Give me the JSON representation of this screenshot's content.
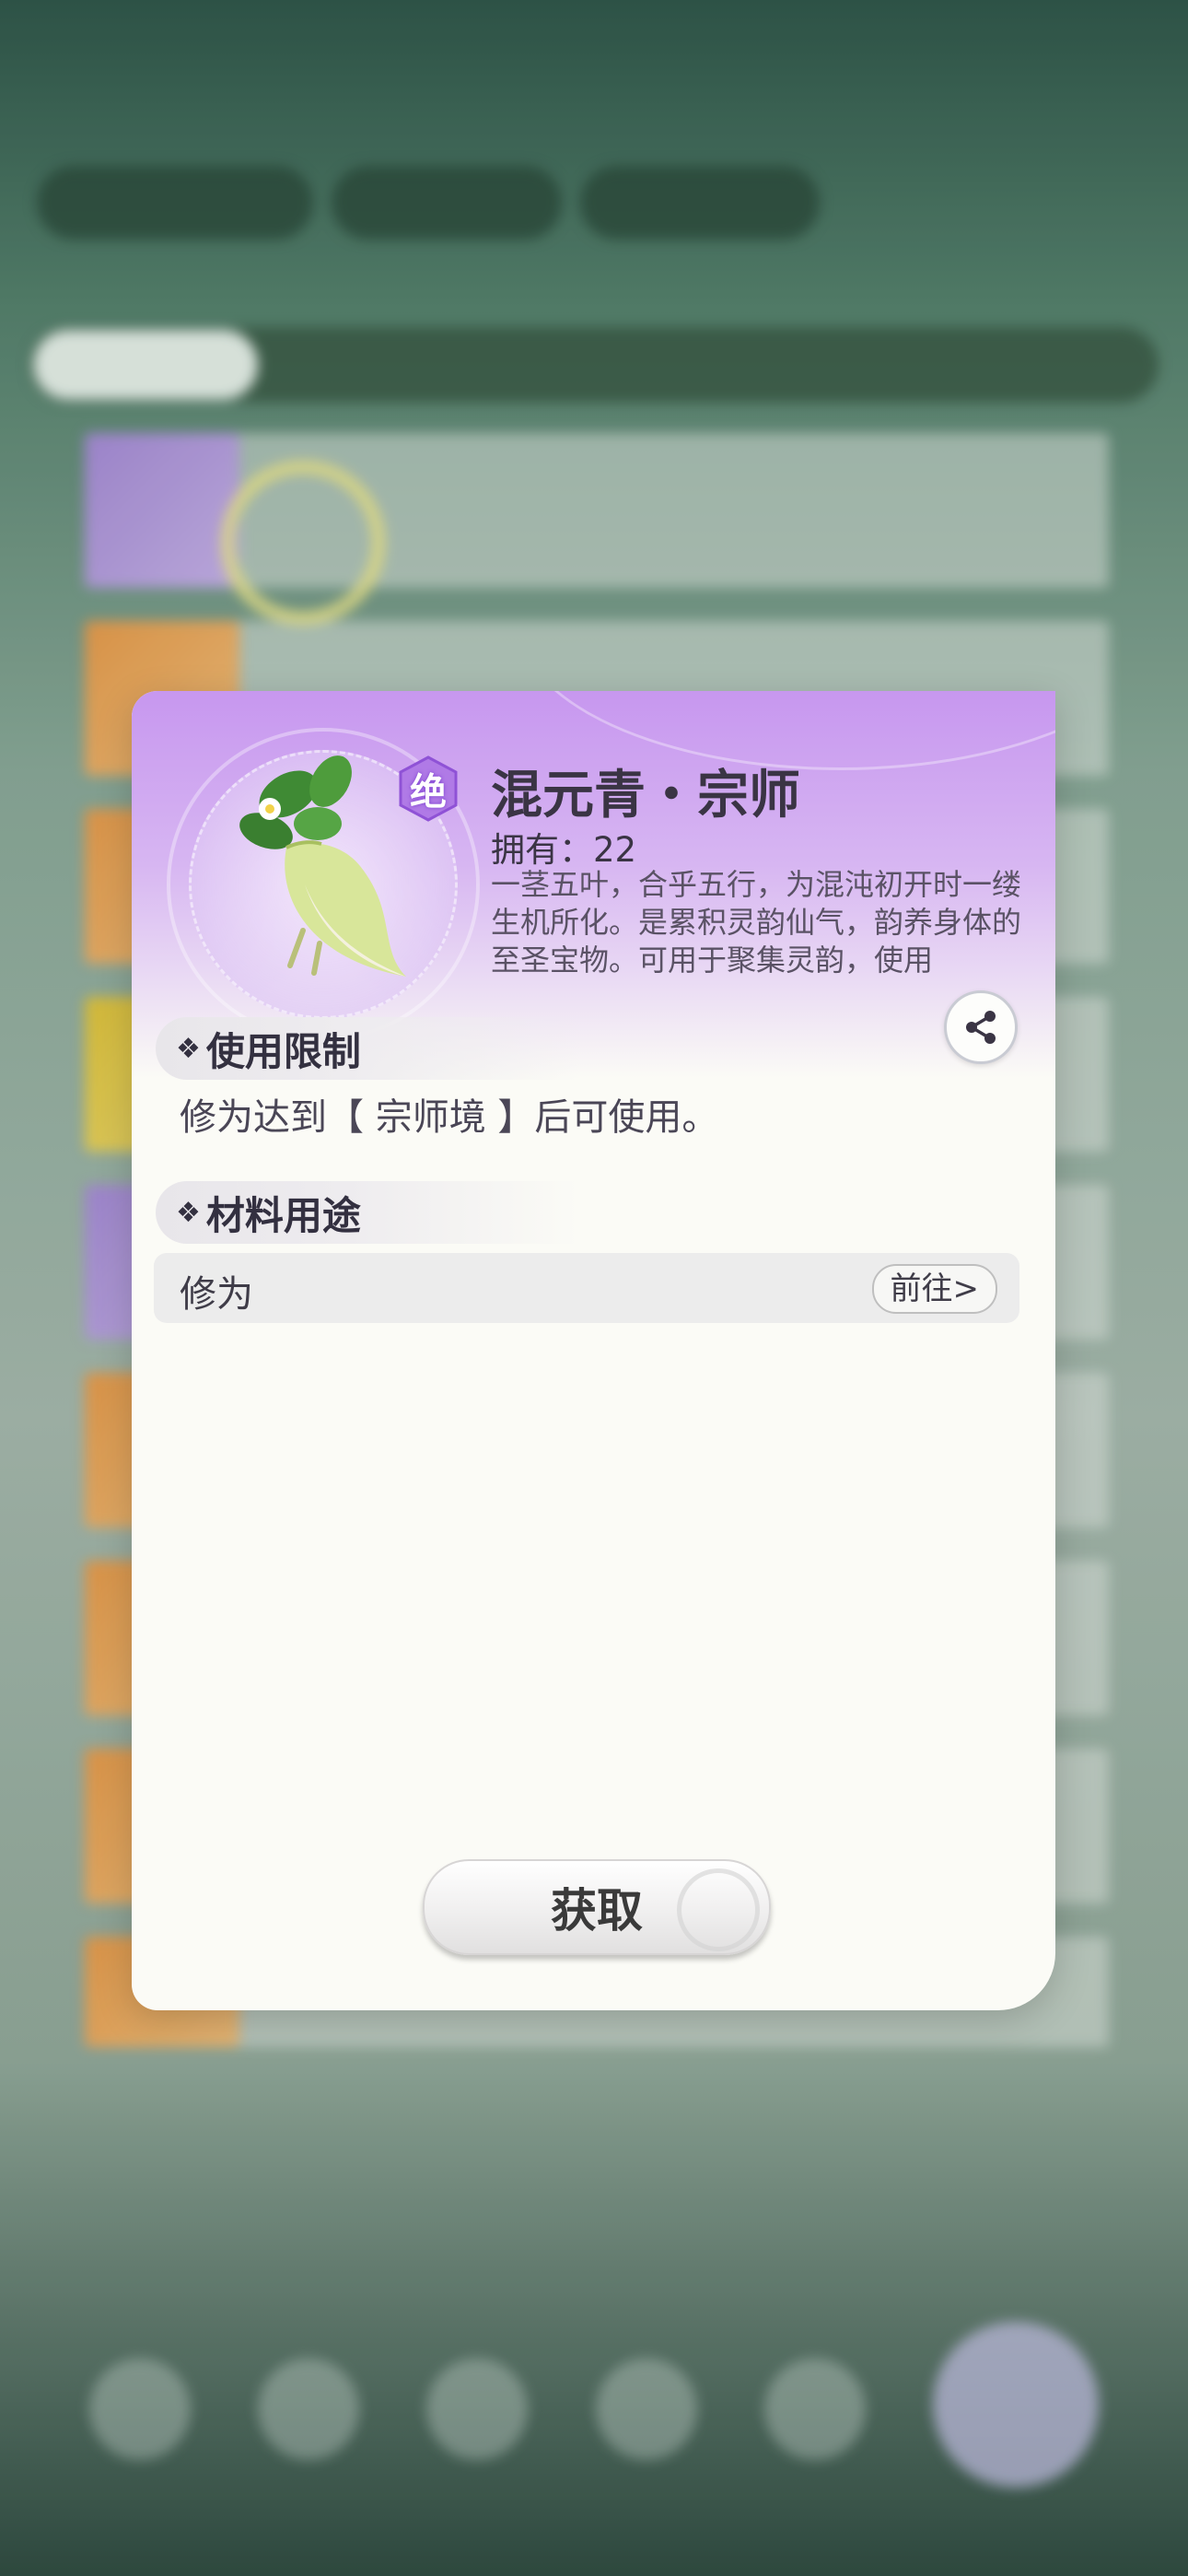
{
  "background": {
    "player": {
      "name": "",
      "level": ""
    },
    "currencies": [
      "",
      ""
    ],
    "tabs": [
      "",
      "",
      "",
      "",
      ""
    ],
    "items": [
      {
        "name": "",
        "count": ""
      },
      {
        "name": "",
        "count": ""
      },
      {
        "name": "",
        "count": ""
      },
      {
        "name": "",
        "count": ""
      },
      {
        "name": "",
        "count": ""
      },
      {
        "name": "",
        "count": ""
      },
      {
        "name": "",
        "count": ""
      },
      {
        "name": "",
        "count": ""
      },
      {
        "name": "",
        "count": ""
      }
    ],
    "capacity_text": "",
    "nav": [
      "",
      "",
      "",
      "",
      "",
      ""
    ]
  },
  "modal": {
    "rarity": "绝",
    "title": "混元青・宗师",
    "owned_label": "拥有：",
    "owned_count": "22",
    "description": "一茎五叶，合乎五行，为混沌初开时一缕生机所化。是累积灵韵仙气，韵养身体的至圣宝物。可用于聚集灵韵，使用",
    "sections": {
      "restriction": {
        "title": "使用限制",
        "text": "修为达到【 宗师境 】后可使用。"
      },
      "usage": {
        "title": "材料用途",
        "row_label": "修为",
        "goto_label": "前往>"
      }
    },
    "obtain_label": "获取"
  },
  "colors": {
    "header_purple": "#c797ef",
    "modal_bg": "#fbfbf6",
    "text_dark": "#3a3444",
    "background_green": "#8aa898"
  },
  "icons": {
    "share": "share-icon",
    "section_marker": "diamond-bullet-icon",
    "item": "radish-icon",
    "rarity": "rarity-badge-icon"
  }
}
